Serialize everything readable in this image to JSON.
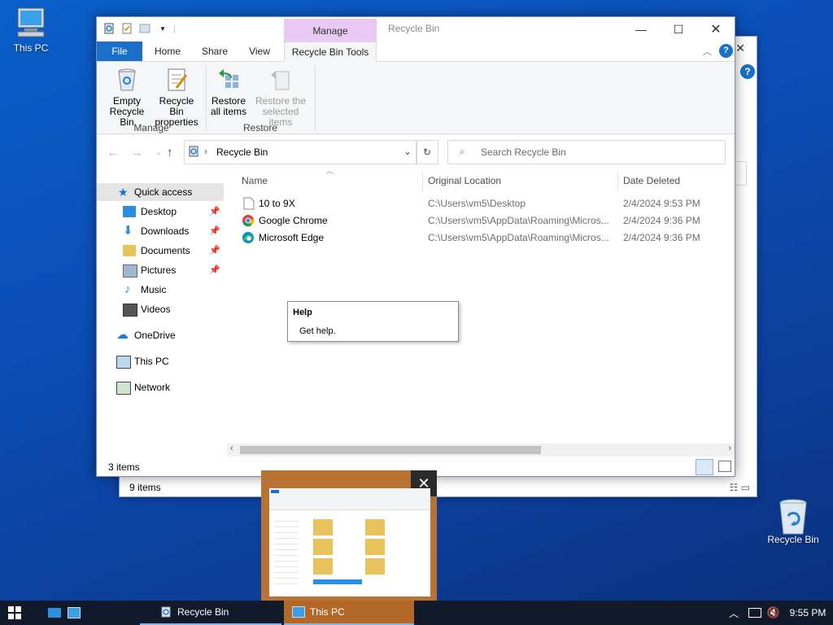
{
  "desktop": {
    "this_pc_label": "This PC",
    "recycle_bin_label": "Recycle Bin"
  },
  "back_window": {
    "status": "9 items"
  },
  "window": {
    "title": "Recycle Bin",
    "context_tab": "Manage",
    "tabs": {
      "file": "File",
      "home": "Home",
      "share": "Share",
      "view": "View",
      "tools": "Recycle Bin Tools"
    },
    "ribbon": {
      "empty": "Empty Recycle Bin",
      "empty_l1": "Empty",
      "empty_l2": "Recycle Bin",
      "props_l1": "Recycle Bin",
      "props_l2": "properties",
      "restore_all_l1": "Restore",
      "restore_all_l2": "all items",
      "restore_sel_l1": "Restore the",
      "restore_sel_l2": "selected items",
      "group_manage": "Manage",
      "group_restore": "Restore"
    },
    "address": "Recycle Bin",
    "search_placeholder": "Search Recycle Bin",
    "nav": [
      {
        "label": "Quick access"
      },
      {
        "label": "Desktop"
      },
      {
        "label": "Downloads"
      },
      {
        "label": "Documents"
      },
      {
        "label": "Pictures"
      },
      {
        "label": "Music"
      },
      {
        "label": "Videos"
      },
      {
        "label": "OneDrive"
      },
      {
        "label": "This PC"
      },
      {
        "label": "Network"
      }
    ],
    "columns": {
      "name": "Name",
      "location": "Original Location",
      "date": "Date Deleted"
    },
    "files": [
      {
        "name": "10 to 9X",
        "location": "C:\\Users\\vm5\\Desktop",
        "date": "2/4/2024 9:53 PM",
        "icon": "file-icon"
      },
      {
        "name": "Google Chrome",
        "location": "C:\\Users\\vm5\\AppData\\Roaming\\Micros...",
        "date": "2/4/2024 9:36 PM",
        "icon": "chrome-icon"
      },
      {
        "name": "Microsoft Edge",
        "location": "C:\\Users\\vm5\\AppData\\Roaming\\Micros...",
        "date": "2/4/2024 9:36 PM",
        "icon": "edge-icon"
      }
    ],
    "status": "3 items"
  },
  "tooltip": {
    "title": "Help",
    "text": "Get help."
  },
  "taskbar": {
    "items": [
      {
        "label": "Recycle Bin"
      },
      {
        "label": "This PC"
      }
    ],
    "clock": "9:55 PM"
  },
  "colors": {
    "accent": "#1a6fc9",
    "context_tab": "#e9c8f3",
    "taskbar_active": "#b36828"
  }
}
